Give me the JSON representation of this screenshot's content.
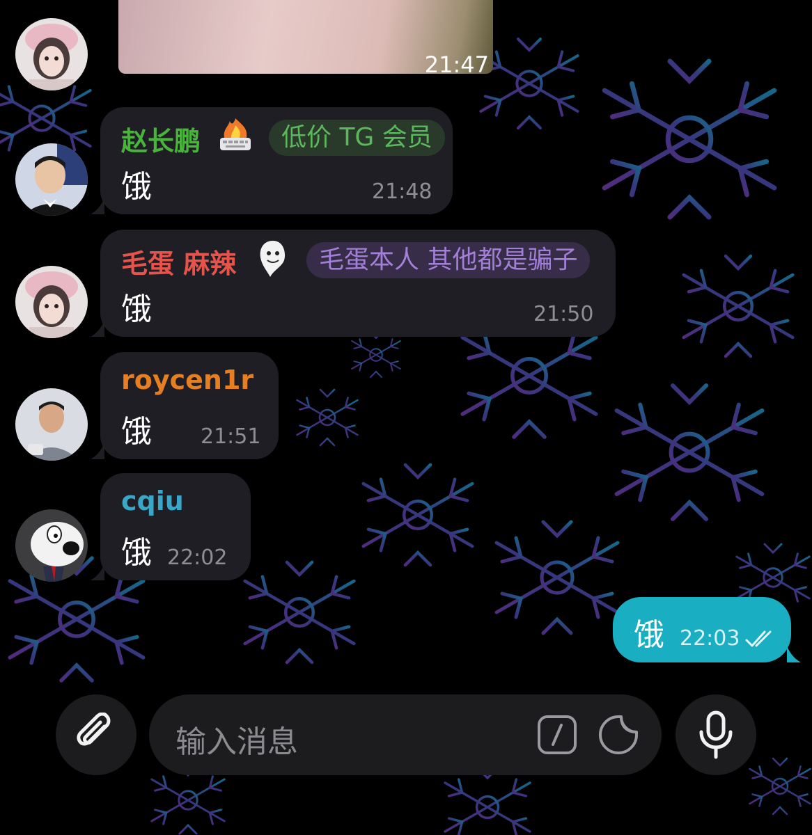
{
  "theme": {
    "bubble_bg": "#1f1e24",
    "outgoing_bg": "#1aaec2",
    "accent": "#1aaec2"
  },
  "media_message": {
    "time": "21:47"
  },
  "messages": [
    {
      "sender": "赵长鹏",
      "sender_color": "#4ab33c",
      "status_emoji": "fire-keyboard",
      "tag": "低价 TG 会员",
      "tag_color": "#5cb85c",
      "text": "饿",
      "time": "21:48"
    },
    {
      "sender": "毛蛋 麻辣",
      "sender_color": "#e5534b",
      "status_emoji": "ghost-sticker",
      "tag": "毛蛋本人 其他都是骗子",
      "tag_color": "#a37fd8",
      "text": "饿",
      "time": "21:50"
    },
    {
      "sender": "roycen1r",
      "sender_color": "#e67e22",
      "text": "饿",
      "time": "21:51"
    },
    {
      "sender": "cqiu",
      "sender_color": "#3aa7c9",
      "text": "饿",
      "time": "22:02"
    }
  ],
  "outgoing": {
    "text": "饿",
    "time": "22:03",
    "status": "read"
  },
  "composer": {
    "placeholder": "输入消息",
    "attach_icon": "paperclip-icon",
    "command_icon": "slash-command-icon",
    "sticker_icon": "sticker-icon",
    "voice_icon": "microphone-icon"
  }
}
